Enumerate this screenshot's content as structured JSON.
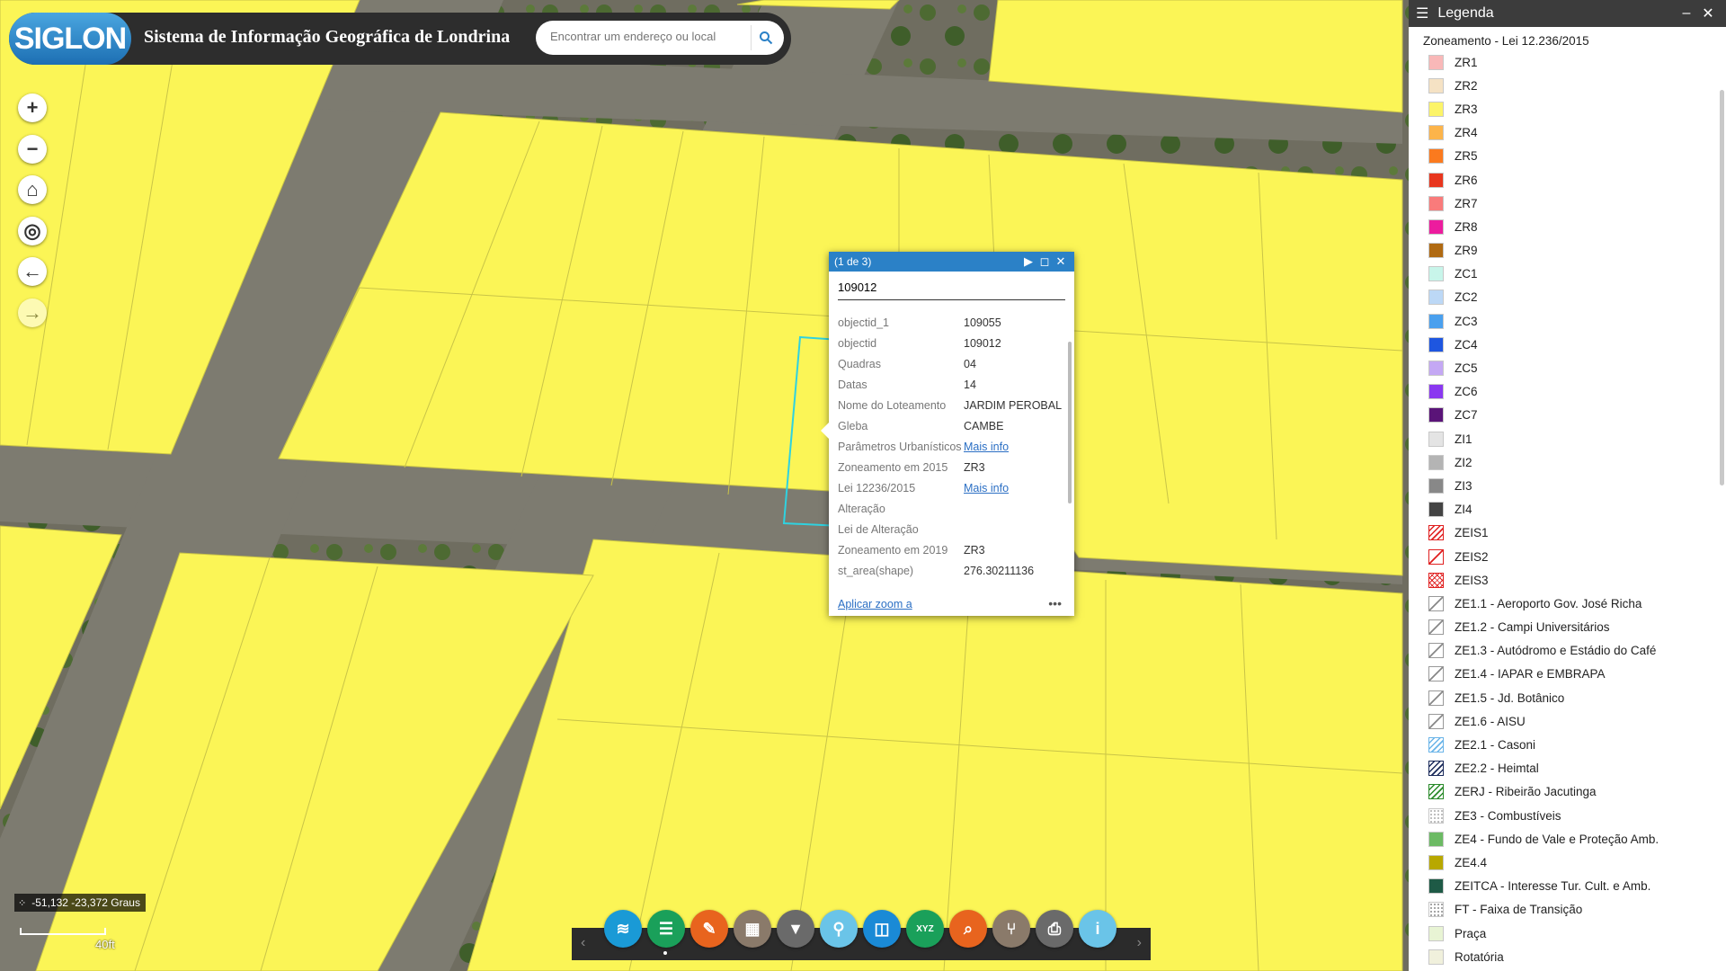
{
  "header": {
    "logo_text": "SIGLON",
    "title": "Sistema de Informação Geográfica de Londrina",
    "search_placeholder": "Encontrar um endereço ou local"
  },
  "map_controls": [
    {
      "name": "zoom-in-button",
      "glyph": "+"
    },
    {
      "name": "zoom-out-button",
      "glyph": "−"
    },
    {
      "name": "home-button",
      "glyph": "⌂"
    },
    {
      "name": "locate-button",
      "glyph": "◎"
    },
    {
      "name": "back-button",
      "glyph": "←"
    },
    {
      "name": "forward-button",
      "glyph": "→"
    }
  ],
  "coordinates": "-51,132 -23,372 Graus",
  "scale_label": "40ft",
  "popup": {
    "count": "(1 de 3)",
    "title": "109012",
    "rows": [
      {
        "key": "objectid_1",
        "value": "109055"
      },
      {
        "key": "objectid",
        "value": "109012"
      },
      {
        "key": "Quadras",
        "value": "04"
      },
      {
        "key": "Datas",
        "value": "14"
      },
      {
        "key": "Nome do Loteamento",
        "value": "JARDIM PEROBAL"
      },
      {
        "key": "Gleba",
        "value": "CAMBE"
      },
      {
        "key": "Parâmetros Urbanísticos",
        "value": "Mais info",
        "link": true
      },
      {
        "key": "Zoneamento em 2015",
        "value": "ZR3"
      },
      {
        "key": "Lei 12236/2015",
        "value": "Mais info",
        "link": true
      },
      {
        "key": "Alteração",
        "value": ""
      },
      {
        "key": "Lei de Alteração",
        "value": ""
      },
      {
        "key": "Zoneamento em 2019",
        "value": "ZR3"
      },
      {
        "key": "st_area(shape)",
        "value": "276.30211136"
      }
    ],
    "zoom_link": "Aplicar zoom a",
    "more": "•••"
  },
  "legend": {
    "title": "Legenda",
    "subtitle": "Zoneamento - Lei 12.236/2015",
    "items": [
      {
        "label": "ZR1",
        "color": "#f9b8b8"
      },
      {
        "label": "ZR2",
        "color": "#f5e2c4"
      },
      {
        "label": "ZR3",
        "color": "#fcf468"
      },
      {
        "label": "ZR4",
        "color": "#fcb44a"
      },
      {
        "label": "ZR5",
        "color": "#fb7a1e"
      },
      {
        "label": "ZR6",
        "color": "#e8361e"
      },
      {
        "label": "ZR7",
        "color": "#f97b7b"
      },
      {
        "label": "ZR8",
        "color": "#ec1c9e"
      },
      {
        "label": "ZR9",
        "color": "#b06a12"
      },
      {
        "label": "ZC1",
        "color": "#c8f5ea"
      },
      {
        "label": "ZC2",
        "color": "#bcd8f6"
      },
      {
        "label": "ZC3",
        "color": "#4aa0ee"
      },
      {
        "label": "ZC4",
        "color": "#1e56e0"
      },
      {
        "label": "ZC5",
        "color": "#c4a8f4"
      },
      {
        "label": "ZC6",
        "color": "#8a38f0"
      },
      {
        "label": "ZC7",
        "color": "#5a1478"
      },
      {
        "label": "ZI1",
        "color": "#e4e4e4"
      },
      {
        "label": "ZI2",
        "color": "#b4b4b4"
      },
      {
        "label": "ZI3",
        "color": "#888888"
      },
      {
        "label": "ZI4",
        "color": "#444444"
      },
      {
        "label": "ZEIS1",
        "color": "#e02020",
        "pattern": "hatch"
      },
      {
        "label": "ZEIS2",
        "color": "#e02020",
        "pattern": "hatch-sparse"
      },
      {
        "label": "ZEIS3",
        "color": "#e02020",
        "pattern": "cross"
      },
      {
        "label": "ZE1.1 - Aeroporto Gov. José Richa",
        "color": "#888888",
        "pattern": "hatch-sparse"
      },
      {
        "label": "ZE1.2 - Campi Universitários",
        "color": "#888888",
        "pattern": "hatch-sparse"
      },
      {
        "label": "ZE1.3 - Autódromo e Estádio do Café",
        "color": "#888888",
        "pattern": "hatch-sparse"
      },
      {
        "label": "ZE1.4 - IAPAR e EMBRAPA",
        "color": "#888888",
        "pattern": "hatch-sparse"
      },
      {
        "label": "ZE1.5 - Jd. Botânico",
        "color": "#888888",
        "pattern": "hatch-sparse"
      },
      {
        "label": "ZE1.6 - AISU",
        "color": "#888888",
        "pattern": "hatch-sparse"
      },
      {
        "label": "ZE2.1 - Casoni",
        "color": "#6ab4e8",
        "pattern": "hatch"
      },
      {
        "label": "ZE2.2 - Heimtal",
        "color": "#1a2a5a",
        "pattern": "hatch"
      },
      {
        "label": "ZERJ - Ribeirão Jacutinga",
        "color": "#2a8a2a",
        "pattern": "hatch"
      },
      {
        "label": "ZE3 - Combustíveis",
        "color": "#aaaaaa",
        "pattern": "dots"
      },
      {
        "label": "ZE4 - Fundo de Vale e Proteção Amb.",
        "color": "#6cba64"
      },
      {
        "label": "ZE4.4",
        "color": "#b8a800"
      },
      {
        "label": "ZEITCA - Interesse Tur. Cult. e Amb.",
        "color": "#1e5a46"
      },
      {
        "label": "FT - Faixa de Transição",
        "color": "#888888",
        "pattern": "dots"
      },
      {
        "label": "Praça",
        "color": "#e8f4d4"
      },
      {
        "label": "Rotatória",
        "color": "#f0f0dc"
      }
    ]
  },
  "toolbar": {
    "tools": [
      {
        "name": "layers-tool-button",
        "icon": "layers-icon",
        "color": "#1a9ad6",
        "glyph": "≋"
      },
      {
        "name": "legend-tool-button",
        "icon": "list-icon",
        "color": "#1aa05a",
        "glyph": "☰"
      },
      {
        "name": "draw-tool-button",
        "icon": "pencil-icon",
        "color": "#e8641e",
        "glyph": "✎"
      },
      {
        "name": "basemap-tool-button",
        "icon": "grid-icon",
        "color": "#8a7a6a",
        "glyph": "▦"
      },
      {
        "name": "filter-tool-button",
        "icon": "filter-icon",
        "color": "#6a6a6a",
        "glyph": "▼"
      },
      {
        "name": "locate-tool-button",
        "icon": "location-icon",
        "color": "#6ac4e8",
        "glyph": "⚲"
      },
      {
        "name": "measure-tool-button",
        "icon": "ruler-icon",
        "color": "#1a8ad6",
        "glyph": "◫"
      },
      {
        "name": "xyz-tool-button",
        "icon": "xyz-icon",
        "color": "#1aa05a",
        "glyph": "XYZ"
      },
      {
        "name": "query-tool-button",
        "icon": "search-map-icon",
        "color": "#e8641e",
        "glyph": "⌕"
      },
      {
        "name": "share-tool-button",
        "icon": "share-icon",
        "color": "#8a7a6a",
        "glyph": "⑂"
      },
      {
        "name": "print-tool-button",
        "icon": "printer-icon",
        "color": "#6a6a6a",
        "glyph": "⎙"
      },
      {
        "name": "info-tool-button",
        "icon": "info-icon",
        "color": "#6ac4e8",
        "glyph": "i"
      }
    ]
  },
  "colors": {
    "parcel_yellow": "#fbf556",
    "road": "#6e6c62",
    "accent": "#2b81c7"
  }
}
